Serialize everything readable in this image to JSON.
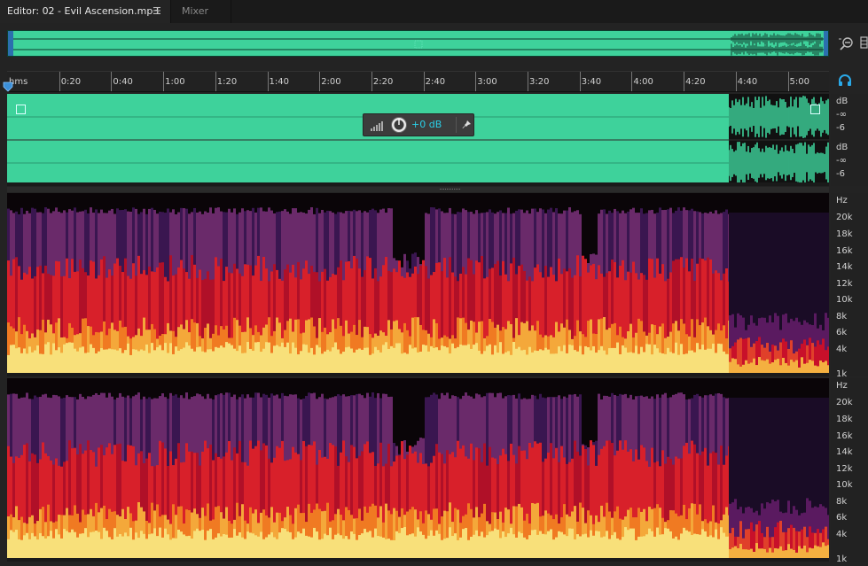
{
  "tabs": {
    "editor_label": "Editor: 02 - Evil Ascension.mp3",
    "mixer_label": "Mixer"
  },
  "icons": {
    "menu": "hamburger-icon",
    "zoom": "zoom-out-icon",
    "headphones": "headphones-icon",
    "playhead": "playhead-marker-icon",
    "pin": "pin-icon",
    "level": "level-meter-icon",
    "knob": "volume-knob-icon"
  },
  "timeline": {
    "ticks": [
      "hms",
      "0:20",
      "0:40",
      "1:00",
      "1:20",
      "1:40",
      "2:00",
      "2:20",
      "2:40",
      "3:00",
      "3:20",
      "3:40",
      "4:00",
      "4:20",
      "4:40",
      "5:00"
    ]
  },
  "db_scale": {
    "ch1": [
      "dB",
      "-∞",
      "-6"
    ],
    "ch2": [
      "dB",
      "-∞",
      "-6"
    ]
  },
  "hud": {
    "volume": "+0 dB"
  },
  "spectral_scale": {
    "unit": "Hz",
    "labels": [
      "20k",
      "18k",
      "16k",
      "14k",
      "12k",
      "10k",
      "8k",
      "6k",
      "4k",
      "1k"
    ]
  },
  "colors": {
    "waveform": "#3ed29b",
    "accent": "#2ad0e8",
    "spectral_low": "#fff08a",
    "spectral_mid": "#e0202a",
    "spectral_high": "#5a2a8a"
  }
}
